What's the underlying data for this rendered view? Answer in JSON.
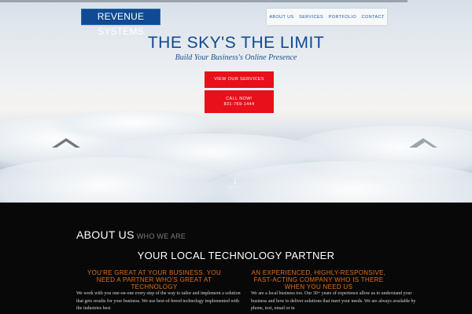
{
  "brand": {
    "logo_text": "REVENUE SYSTEMS"
  },
  "nav": {
    "items": [
      {
        "label": "ABOUT US"
      },
      {
        "label": "SERVICES"
      },
      {
        "label": "PORTFOLIO"
      },
      {
        "label": "CONTACT"
      }
    ]
  },
  "hero": {
    "headline": "THE SKY'S THE LIMIT",
    "tagline": "Build Your Business's Online Presence",
    "button_services": "VIEW OUR SERVICES",
    "button_call_line1": "CALL NOW!",
    "button_call_line2": "831-769-1444",
    "scroll_label": "SCROLL"
  },
  "about": {
    "title": "ABOUT US",
    "subtitle": "WHO WE ARE",
    "heading": "YOUR LOCAL TECHNOLOGY PARTNER",
    "left": {
      "heading": "YOU'RE GREAT AT YOUR BUSINESS. YOU NEED A PARTNER WHO'S GREAT AT TECHNOLOGY",
      "body": "We work with you one-on-one every step of the way to tailor and implement a solution that gets results for your business. We use best-of-breed technology implemented with the industries best"
    },
    "right": {
      "heading": "AN EXPERIENCED, HIGHLY-RESPONSIVE, FAST-ACTING COMPANY WHO IS THERE WHEN YOU NEED US",
      "body": "We are a local business too. Our 30+ years of experience allow us to understand your business and how to deliver solutions that meet your needs. We are always available by phone, text, email or in"
    }
  },
  "colors": {
    "brand_blue": "#0f4a92",
    "cta_red": "#e8101a",
    "accent_orange": "#e0701a",
    "dark_bg": "#080808"
  },
  "icons": {
    "scroll": "arrow-down-icon"
  }
}
